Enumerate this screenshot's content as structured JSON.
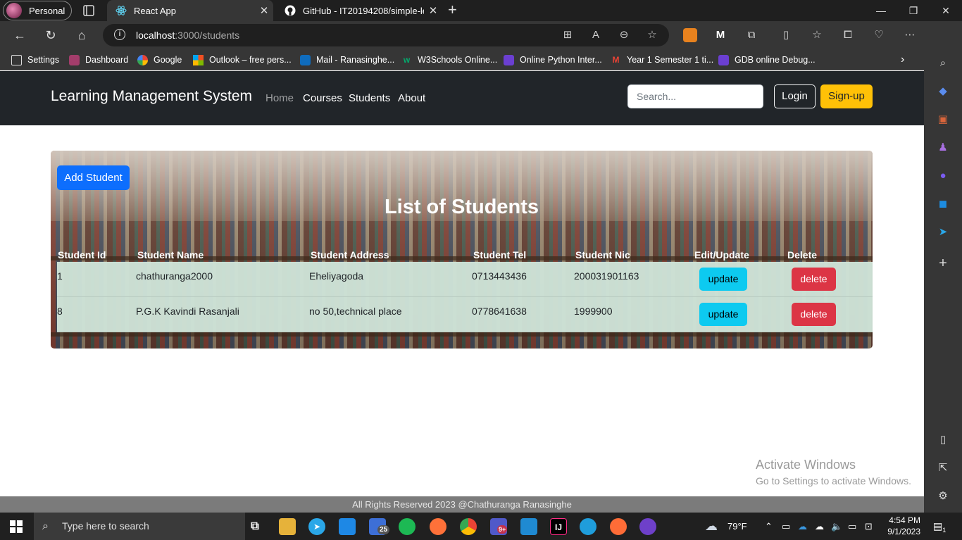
{
  "browser": {
    "profile_label": "Personal",
    "tabs": [
      {
        "title": "React App",
        "active": true
      },
      {
        "title": "GitHub - IT20194208/simple-lea",
        "active": false
      }
    ],
    "url_host": "localhost",
    "url_path": ":3000/students",
    "bookmarks": [
      {
        "label": "Settings",
        "icon": "file-icon"
      },
      {
        "label": "Dashboard",
        "icon": "dashboard-icon"
      },
      {
        "label": "Google",
        "icon": "google-icon"
      },
      {
        "label": "Outlook – free pers...",
        "icon": "microsoft-icon"
      },
      {
        "label": "Mail - Ranasinghe...",
        "icon": "outlook-icon"
      },
      {
        "label": "W3Schools Online...",
        "icon": "w3schools-icon"
      },
      {
        "label": "Online Python Inter...",
        "icon": "bolt-icon"
      },
      {
        "label": "Year 1 Semester 1 ti...",
        "icon": "gmail-icon"
      },
      {
        "label": "GDB online Debug...",
        "icon": "bolt-icon"
      }
    ]
  },
  "app": {
    "brand": "Learning Management System",
    "nav": [
      "Home",
      "Courses",
      "Students",
      "About"
    ],
    "search_placeholder": "Search...",
    "login_label": "Login",
    "signup_label": "Sign-up",
    "add_student_label": "Add Student",
    "heading": "List of Students",
    "columns": [
      "Student Id",
      "Student Name",
      "Student Address",
      "Student Tel",
      "Student Nic",
      "Edit/Update",
      "Delete"
    ],
    "rows": [
      {
        "id": "1",
        "name": "chathuranga2000",
        "address": "Eheliyagoda",
        "tel": "0713443436",
        "nic": "200031901163",
        "update": "update",
        "delete": "delete"
      },
      {
        "id": "8",
        "name": "P.G.K Kavindi Rasanjali",
        "address": "no 50,technical place",
        "tel": "0778641638",
        "nic": "1999900",
        "update": "update",
        "delete": "delete"
      }
    ],
    "footer": "All Rights Reserved 2023 @Chathuranga Ranasinghe"
  },
  "watermark": {
    "line1": "Activate Windows",
    "line2": "Go to Settings to activate Windows."
  },
  "taskbar": {
    "search_placeholder": "Type here to search",
    "mail_badge": "25",
    "teams_badge": "9+",
    "weather": "79°F",
    "time": "4:54 PM",
    "date": "9/1/2023",
    "notification_count": "1"
  },
  "colors": {
    "navbar": "#212529",
    "primary": "#0d6efd",
    "warning": "#ffc107",
    "info": "#0dcaf0",
    "danger": "#dc3545"
  }
}
